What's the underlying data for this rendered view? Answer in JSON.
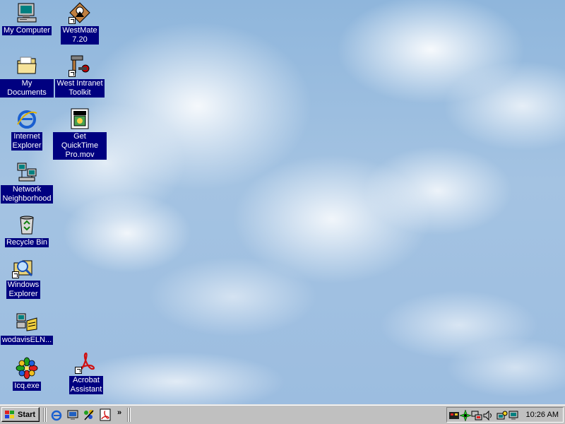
{
  "desktop": {
    "icons": [
      {
        "label": "My Computer",
        "icon": "computer-icon"
      },
      {
        "label": "WestMate\n7.20",
        "icon": "westmate-icon",
        "shortcut": true
      },
      {
        "label": "My Documents",
        "icon": "folder-icon"
      },
      {
        "label": "West Intranet\nToolkit",
        "icon": "toolkit-icon",
        "shortcut": true
      },
      {
        "label": "Internet\nExplorer",
        "icon": "internet-explorer-icon"
      },
      {
        "label": "Get QuickTime\nPro.mov",
        "icon": "movie-file-icon"
      },
      {
        "label": "Network\nNeighborhood",
        "icon": "network-icon"
      },
      {
        "label": "Recycle Bin",
        "icon": "recycle-bin-icon"
      },
      {
        "label": "Windows\nExplorer",
        "icon": "windows-explorer-icon",
        "shortcut": true
      },
      {
        "label": "wodavisELN...",
        "icon": "eln-icon"
      },
      {
        "label": "Icq.exe",
        "icon": "icq-flower-icon"
      },
      {
        "label": "Acrobat\nAssistant",
        "icon": "acrobat-icon",
        "shortcut": true
      }
    ],
    "colors": {
      "selection": "#000080",
      "sky": "#9cbde0"
    }
  },
  "taskbar": {
    "start_label": "Start",
    "quick_launch": [
      {
        "icon": "internet-explorer-icon"
      },
      {
        "icon": "show-desktop-icon"
      },
      {
        "icon": "channels-icon"
      },
      {
        "icon": "acrobat-icon"
      }
    ],
    "more_label": "»",
    "tray": [
      {
        "icon": "tray-app-icon"
      },
      {
        "icon": "tray-starburst-icon"
      },
      {
        "icon": "tray-network-icon"
      },
      {
        "icon": "speaker-icon"
      },
      {
        "icon": "tray-scheduler-icon"
      },
      {
        "icon": "tray-monitor-icon"
      }
    ],
    "clock": "10:26 AM"
  }
}
